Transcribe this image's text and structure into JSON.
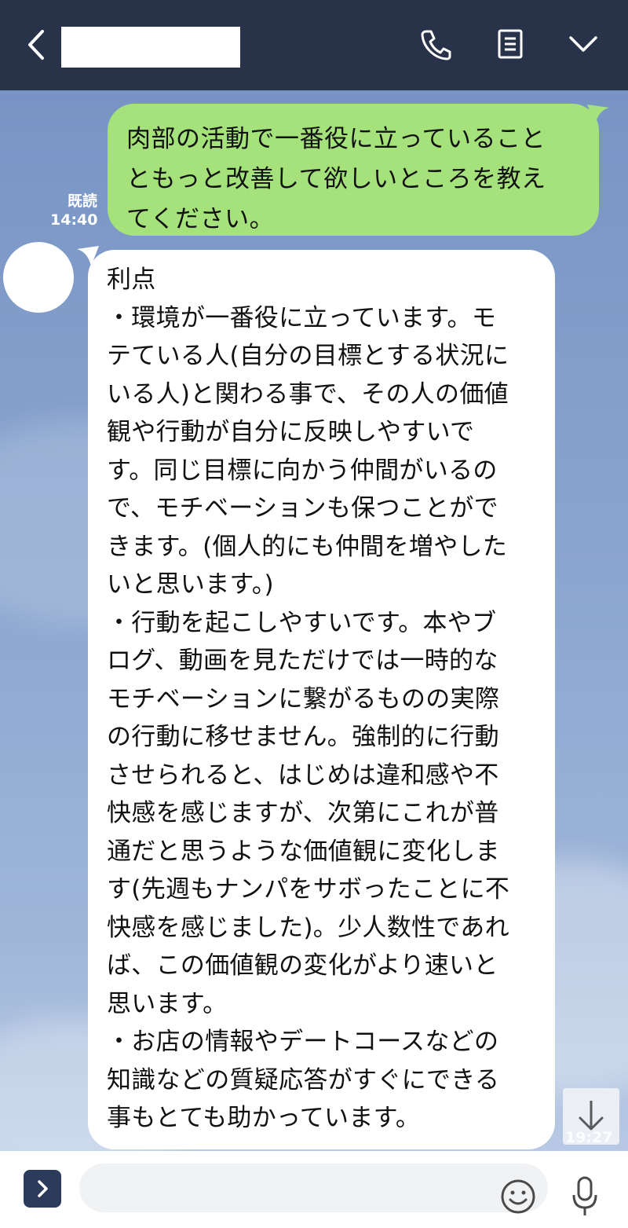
{
  "header": {
    "contact_name": "",
    "icons": [
      "back-chevron-icon",
      "phone-icon",
      "notes-icon",
      "chevron-down-icon"
    ]
  },
  "messages": [
    {
      "direction": "outgoing",
      "text": "肉部の活動で一番役に立っていること\nともっと改善して欲しいところを教え\nてください。",
      "read_label": "既読",
      "time": "14:40"
    },
    {
      "direction": "incoming",
      "text": "利点\n・環境が一番役に立っています。モ\nテている人(自分の目標とする状況に\nいる人)と関わる事で、その人の価値\n観や行動が自分に反映しやすいで\nす。同じ目標に向かう仲間がいるの\nで、モチベーションも保つことがで\nきます。(個人的にも仲間を増やした\nいと思います。)\n・行動を起こしやすいです。本やブ\nログ、動画を見ただけでは一時的な\nモチベーションに繋がるものの実際\nの行動に移せません。強制的に行動\nさせられると、はじめは違和感や不\n快感を感じますが、次第にこれが普\n通だと思うような価値観に変化しま\nす(先週もナンパをサボったことに不\n快感を感じました)。少人数性であれ\nば、この価値観の変化がより速いと\n思います。\n・お店の情報やデートコースなどの\n知識などの質疑応答がすぐにできる\n事もとても助かっています。"
    }
  ],
  "partial_timestamp": "19:27",
  "composer": {
    "placeholder": "",
    "icons": [
      "expand-icon",
      "emoji-icon",
      "microphone-icon"
    ]
  },
  "colors": {
    "header_bg": "#283249",
    "outgoing_bubble": "#a5e27c",
    "incoming_bubble": "#ffffff",
    "chat_bg": "#7f9cc9"
  }
}
